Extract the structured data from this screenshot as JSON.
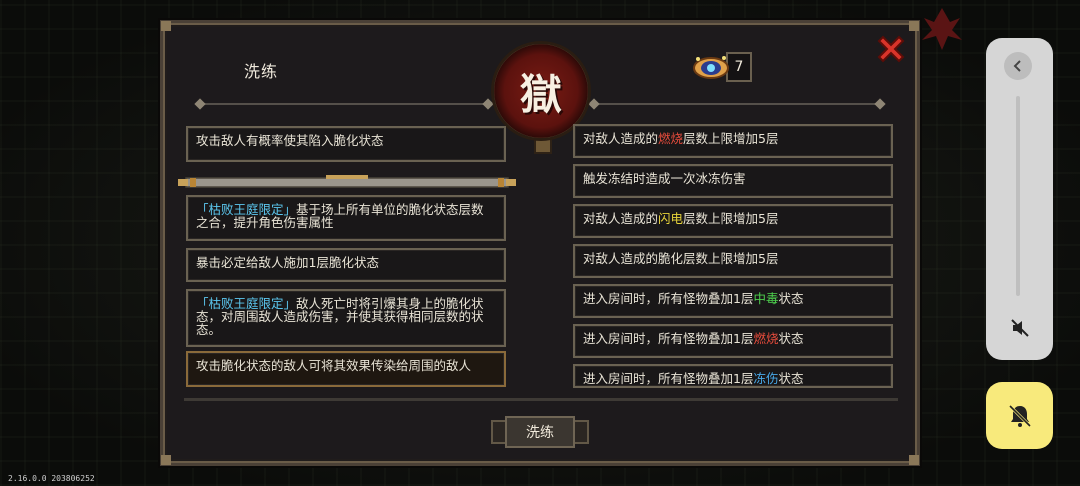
{
  "panel": {
    "title": "洗练",
    "emblem_char": "獄",
    "currency": {
      "icon": "eye-gem-icon",
      "count": "7"
    }
  },
  "left_items": [
    {
      "segments": [
        {
          "text": "攻击敌人有概率使其陷入脆化状态",
          "color": ""
        }
      ],
      "selected": false
    },
    {
      "segments": [
        {
          "text": "「枯败王庭限定」",
          "color": "#5cc8f0"
        },
        {
          "text": "基于场上所有单位的脆化状态层数之合，提升角色伤害属性",
          "color": ""
        }
      ],
      "selected": false
    },
    {
      "segments": [
        {
          "text": "暴击必定给敌人施加1层脆化状态",
          "color": ""
        }
      ],
      "selected": false
    },
    {
      "segments": [
        {
          "text": "「枯败王庭限定」",
          "color": "#5cc8f0"
        },
        {
          "text": "敌人死亡时将引爆其身上的脆化状态，对周围敌人造成伤害，并使其获得相同层数的状态。",
          "color": ""
        }
      ],
      "selected": false
    },
    {
      "segments": [
        {
          "text": "攻击脆化状态的敌人可将其效果传染给周围的敌人",
          "color": ""
        }
      ],
      "selected": true
    }
  ],
  "right_items": [
    {
      "segments": [
        {
          "text": "对敌人造成的",
          "color": ""
        },
        {
          "text": "燃烧",
          "color": "#e74c3c"
        },
        {
          "text": "层数上限增加5层",
          "color": ""
        }
      ]
    },
    {
      "segments": [
        {
          "text": "触发冻结时造成一次冰冻伤害",
          "color": ""
        }
      ]
    },
    {
      "segments": [
        {
          "text": "对敌人造成的",
          "color": ""
        },
        {
          "text": "闪电",
          "color": "#e7d33a"
        },
        {
          "text": "层数上限增加5层",
          "color": ""
        }
      ]
    },
    {
      "segments": [
        {
          "text": "对敌人造成的脆化层数上限增加5层",
          "color": ""
        }
      ]
    },
    {
      "segments": [
        {
          "text": "进入房间时，所有怪物叠加1层",
          "color": ""
        },
        {
          "text": "中毒",
          "color": "#4ed24e"
        },
        {
          "text": "状态",
          "color": ""
        }
      ]
    },
    {
      "segments": [
        {
          "text": "进入房间时，所有怪物叠加1层",
          "color": ""
        },
        {
          "text": "燃烧",
          "color": "#e74c3c"
        },
        {
          "text": "状态",
          "color": ""
        }
      ]
    },
    {
      "segments": [
        {
          "text": "进入房间时，所有怪物叠加1层",
          "color": ""
        },
        {
          "text": "冻伤",
          "color": "#48a8e8"
        },
        {
          "text": "状态",
          "color": ""
        }
      ]
    }
  ],
  "refine_button": {
    "label": "洗练"
  },
  "colors": {
    "panel_bg": "#1d1a1c",
    "close_red": "#d8342a",
    "accent_yellow": "#f8ea7c"
  },
  "version": "2.16.0.0 203806252"
}
